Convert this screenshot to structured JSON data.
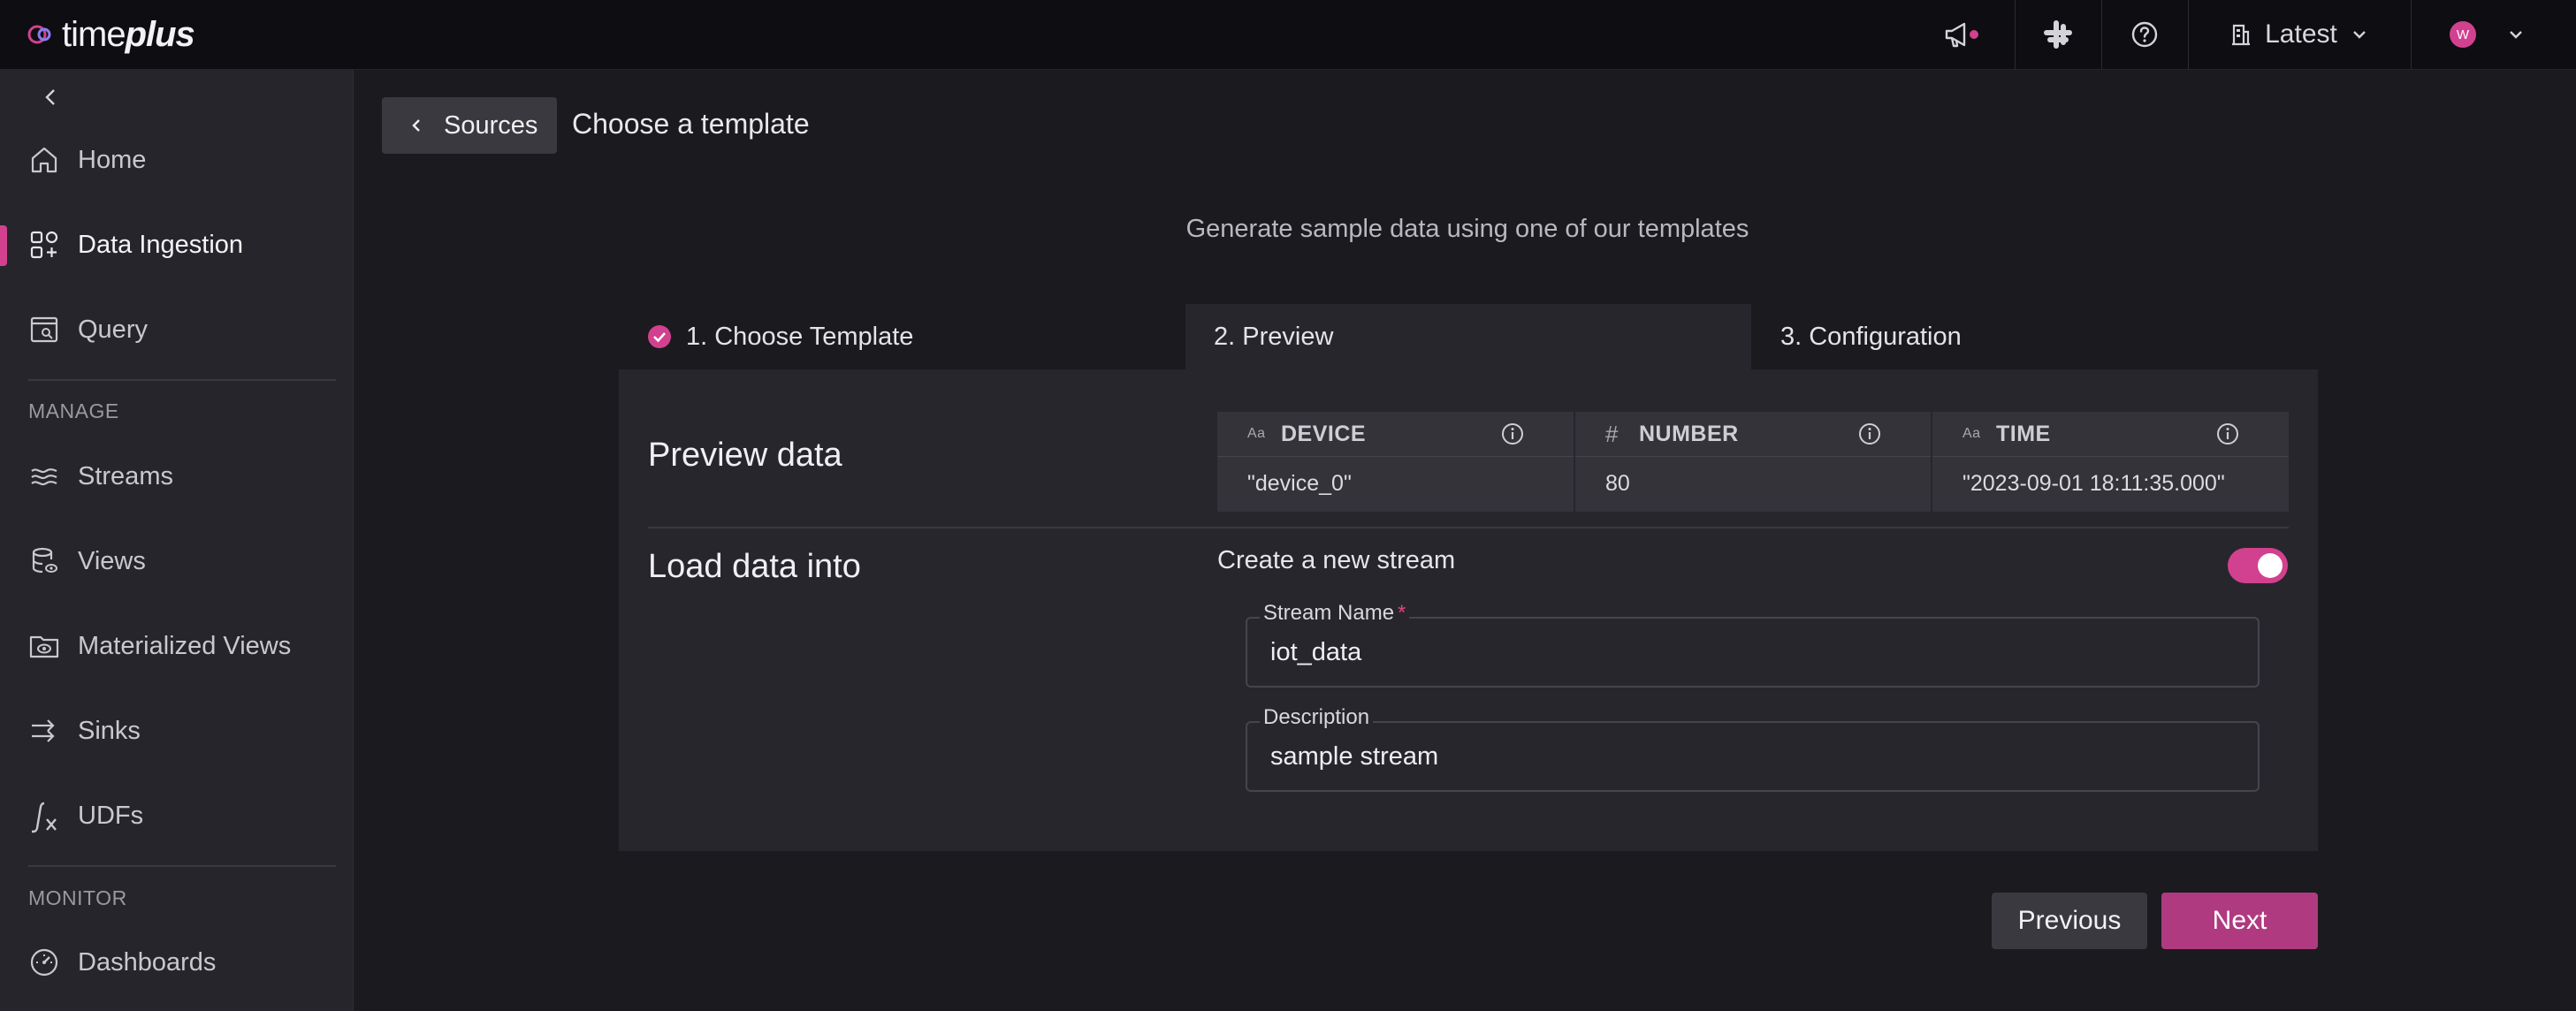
{
  "app": {
    "logo_text_light": "time",
    "logo_text_bold": "plus",
    "version_selector": "Latest",
    "avatar_initial": "W"
  },
  "sidebar": {
    "items_top": [
      {
        "label": "Home",
        "icon": "home-icon"
      },
      {
        "label": "Data Ingestion",
        "icon": "data-ingestion-icon",
        "active": true
      },
      {
        "label": "Query",
        "icon": "query-icon"
      }
    ],
    "manage_section": "MANAGE",
    "items_manage": [
      {
        "label": "Streams",
        "icon": "streams-icon"
      },
      {
        "label": "Views",
        "icon": "views-icon"
      },
      {
        "label": "Materialized Views",
        "icon": "materialized-views-icon"
      },
      {
        "label": "Sinks",
        "icon": "sinks-icon"
      },
      {
        "label": "UDFs",
        "icon": "udfs-icon"
      }
    ],
    "monitor_section": "MONITOR",
    "items_monitor": [
      {
        "label": "Dashboards",
        "icon": "dashboards-icon"
      }
    ]
  },
  "header": {
    "back_label": "Sources",
    "title": "Choose a template"
  },
  "subtitle": "Generate sample data using one of our templates",
  "steps": [
    {
      "label": "1. Choose Template",
      "state": "done"
    },
    {
      "label": "2. Preview",
      "state": "active"
    },
    {
      "label": "3. Configuration",
      "state": "pending"
    }
  ],
  "preview": {
    "section_label": "Preview data",
    "columns": [
      {
        "type": "Aa",
        "name": "DEVICE",
        "value": "\"device_0\""
      },
      {
        "type": "#",
        "name": "NUMBER",
        "value": "80"
      },
      {
        "type": "Aa",
        "name": "TIME",
        "value": "\"2023-09-01 18:11:35.000\""
      }
    ]
  },
  "load": {
    "section_label": "Load data into",
    "toggle_label": "Create a new stream",
    "toggle_on": true,
    "stream_name_label": "Stream Name",
    "stream_name_required": "*",
    "stream_name_value": "iot_data",
    "description_label": "Description",
    "description_value": "sample stream"
  },
  "footer": {
    "previous_label": "Previous",
    "next_label": "Next"
  },
  "colors": {
    "accent": "#d2418f",
    "next_button": "#b03a80",
    "background": "#1b1a1f",
    "sidebar": "#26252b",
    "topbar": "#0e0d11"
  }
}
